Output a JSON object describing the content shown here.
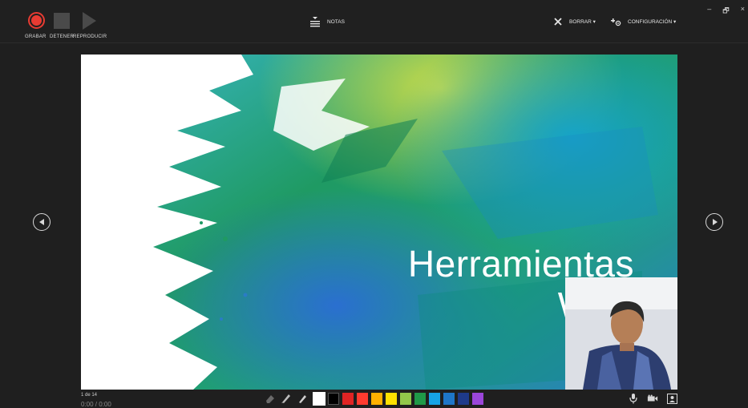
{
  "toolbar": {
    "record_label": "GRABAR",
    "stop_label": "DETENER",
    "play_label": "REPRODUCIR",
    "notes_label": "NOTAS",
    "clear_label": "BORRAR ▾",
    "settings_label": "CONFIGURACIÓN ▾"
  },
  "window_controls": {
    "minimize": "–",
    "restore": "🗗",
    "close": "×"
  },
  "slide": {
    "title_line1": "Herramientas",
    "title_line2": "Web"
  },
  "status": {
    "page": "1 de 14",
    "time": "0:00 / 0:00"
  },
  "colors": {
    "record_red": "#e83b32",
    "background": "#1f1f1f",
    "swatches": [
      "#ffffff",
      "#000000",
      "#e02424",
      "#ff3b2f",
      "#ffb000",
      "#ffe100",
      "#92c84a",
      "#1f9a48",
      "#16a3e6",
      "#1e76c8",
      "#1e3a8a",
      "#9b46d9"
    ]
  },
  "icons": [
    "record-icon",
    "stop-icon",
    "play-icon",
    "notes-icon",
    "clear-icon",
    "settings-icon",
    "prev-slide-icon",
    "next-slide-icon",
    "eraser-icon",
    "pen-icon",
    "highlighter-icon",
    "microphone-icon",
    "camera-icon",
    "camera-preview-icon"
  ]
}
